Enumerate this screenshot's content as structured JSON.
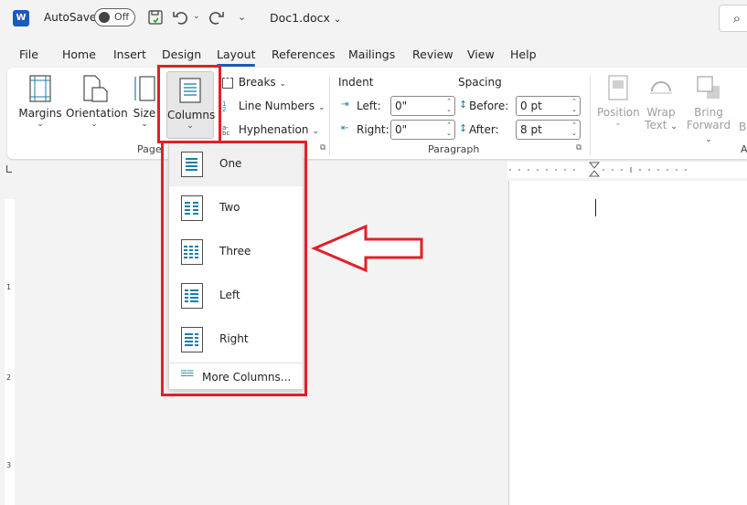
{
  "titlebar": {
    "app_logo": "W",
    "autosave_label": "AutoSave",
    "autosave_state": "Off",
    "doc_title": "Doc1.docx",
    "icons": [
      "save-icon",
      "undo-icon",
      "redo-icon",
      "customize-icon"
    ],
    "search_icon": "search-icon"
  },
  "tabs": [
    "File",
    "Home",
    "Insert",
    "Design",
    "Layout",
    "References",
    "Mailings",
    "Review",
    "View",
    "Help"
  ],
  "ribbon": {
    "page_setup": {
      "margins": "Margins",
      "orientation": "Orientation",
      "size": "Size",
      "columns": "Columns",
      "breaks": "Breaks",
      "line_numbers": "Line Numbers",
      "hyphenation": "Hyphenation",
      "group_label": "Page"
    },
    "paragraph": {
      "indent_label": "Indent",
      "spacing_label": "Spacing",
      "left_label": "Left:",
      "left_value": "0\"",
      "right_label": "Right:",
      "right_value": "0\"",
      "before_label": "Before:",
      "before_value": "0 pt",
      "after_label": "After:",
      "after_value": "8 pt",
      "group_label": "Paragraph"
    },
    "arrange": {
      "position_line1": "Position",
      "wrap_line1": "Wrap",
      "wrap_line2": "Text",
      "bring_line1": "Bring",
      "bring_line2": "Forward",
      "cut_label": "B",
      "group_label_partial": "A"
    }
  },
  "columns_menu": {
    "items": [
      "One",
      "Two",
      "Three",
      "Left",
      "Right"
    ],
    "selected": "One",
    "more": "More Columns..."
  },
  "vruler_labels": [
    "1",
    "2",
    "3"
  ],
  "colors": {
    "accent": "#185abd",
    "highlight": "#e0202a",
    "column_line": "#1a7fa8"
  }
}
